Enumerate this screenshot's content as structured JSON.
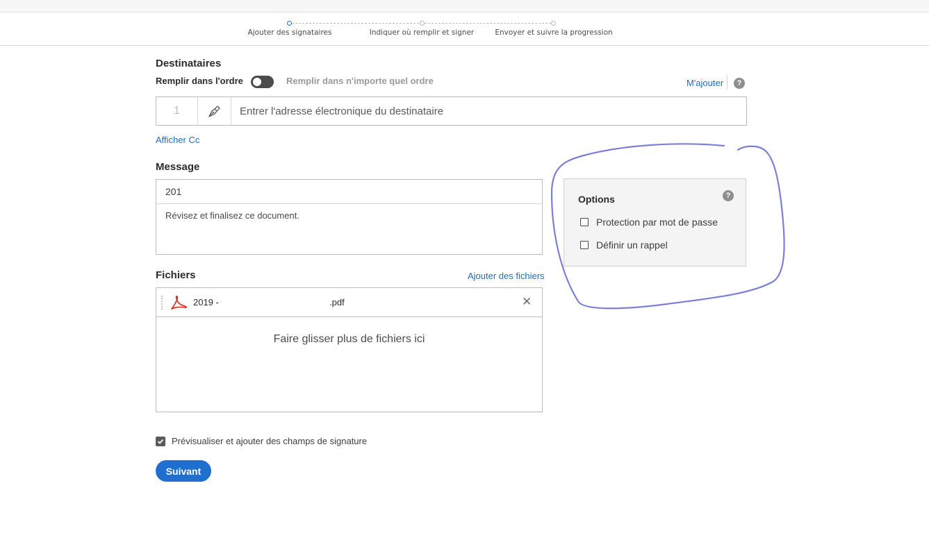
{
  "stepper": {
    "steps": [
      {
        "label": "Ajouter des signataires",
        "active": true
      },
      {
        "label": "Indiquer où remplir et signer",
        "active": false
      },
      {
        "label": "Envoyer et suivre la progression",
        "active": false
      }
    ]
  },
  "recipients": {
    "title": "Destinataires",
    "order_label": "Remplir dans l'ordre",
    "any_order_label": "Remplir dans n'importe quel ordre",
    "add_me_link": "M'ajouter",
    "help_glyph": "?",
    "recipient_number": "1",
    "email_placeholder": "Entrer l'adresse électronique du destinataire",
    "show_cc_link": "Afficher Cc",
    "role_icon": "pen-icon"
  },
  "message": {
    "title": "Message",
    "subject_value": "201",
    "body_value": "Révisez et finalisez ce document."
  },
  "files": {
    "title": "Fichiers",
    "add_files_link": "Ajouter des fichiers",
    "items": [
      {
        "name": "2019 -",
        "ext": ".pdf",
        "icon": "pdf-icon"
      }
    ],
    "remove_glyph": "✕",
    "drop_text": "Faire glisser plus de fichiers ici"
  },
  "options": {
    "title": "Options",
    "help_glyph": "?",
    "items": [
      {
        "label": "Protection par mot de passe",
        "checked": false
      },
      {
        "label": "Définir un rappel",
        "checked": false
      }
    ]
  },
  "footer": {
    "preview_label": "Prévisualiser et ajouter des champs de signature",
    "preview_checked": true,
    "next_button": "Suivant"
  },
  "colors": {
    "accent": "#1e6fd0",
    "link": "#1b6ec2",
    "annotation": "#7b7fd8"
  }
}
